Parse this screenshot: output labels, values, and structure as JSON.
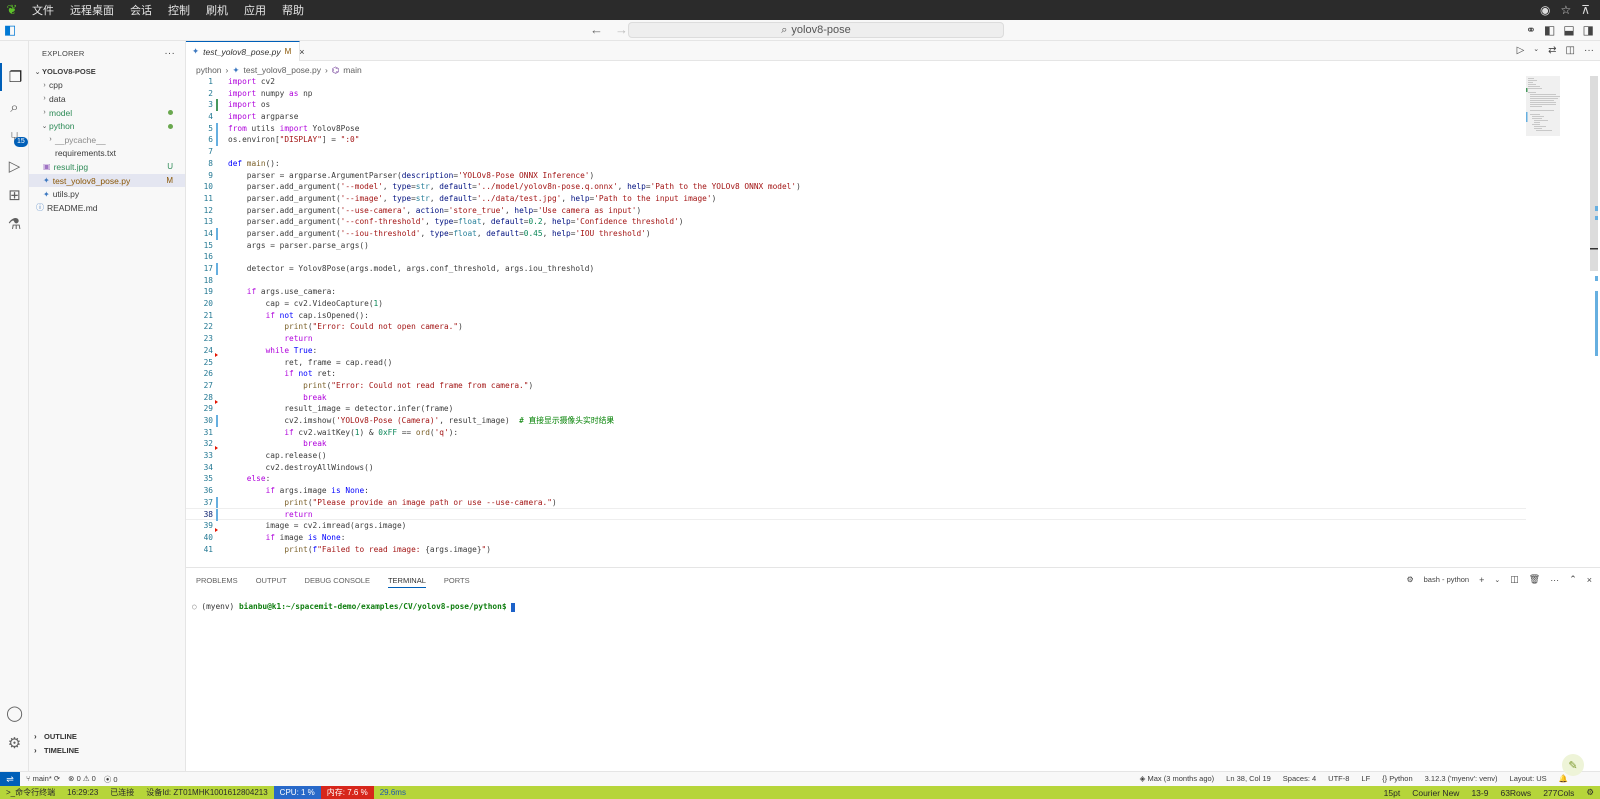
{
  "remote_menu": {
    "items": [
      "文件",
      "远程桌面",
      "会话",
      "控制",
      "刷机",
      "应用",
      "帮助"
    ]
  },
  "titlebar": {
    "back_icon": "arrow-left-icon",
    "forward_icon": "arrow-right-icon",
    "search_text": "yolov8-pose"
  },
  "activity_bar": {
    "items": [
      "explorer",
      "search",
      "source-control",
      "run-debug",
      "extensions",
      "testing"
    ],
    "scm_badge": "15"
  },
  "sidebar": {
    "title": "EXPLORER",
    "root": "YOLOV8-POSE",
    "tree": [
      {
        "label": "cpp",
        "type": "folder",
        "status": ""
      },
      {
        "label": "data",
        "type": "folder",
        "status": ""
      },
      {
        "label": "model",
        "type": "folder",
        "status": "dot"
      },
      {
        "label": "python",
        "type": "folder-open",
        "status": "dot"
      },
      {
        "label": "__pycache__",
        "type": "folder",
        "status": ""
      },
      {
        "label": "requirements.txt",
        "type": "file",
        "status": ""
      },
      {
        "label": "result.jpg",
        "type": "file",
        "status": "U"
      },
      {
        "label": "test_yolov8_pose.py",
        "type": "file",
        "status": "M"
      },
      {
        "label": "utils.py",
        "type": "file",
        "status": ""
      },
      {
        "label": "README.md",
        "type": "file",
        "status": ""
      }
    ],
    "outline": "OUTLINE",
    "timeline": "TIMELINE"
  },
  "editor": {
    "tab_label": "test_yolov8_pose.py",
    "tab_status": "M",
    "breadcrumb": [
      "python",
      "test_yolov8_pose.py",
      "main"
    ],
    "current_line": 38
  },
  "panel": {
    "tabs": [
      "PROBLEMS",
      "OUTPUT",
      "DEBUG CONSOLE",
      "TERMINAL",
      "PORTS"
    ],
    "active_tab": "TERMINAL",
    "terminal_name": "bash - python",
    "prompt_env": "(myenv) ",
    "prompt_user": "bianbu@k1:~/spacemit-demo/examples/CV/yolov8-pose/python$"
  },
  "statusbar": {
    "branch": "main*",
    "errors": "0",
    "warnings": "0",
    "ports": "0",
    "blame": "Max (3 months ago)",
    "position": "Ln 38, Col 19",
    "spaces": "Spaces: 4",
    "encoding": "UTF-8",
    "eol": "LF",
    "language": "Python",
    "interpreter": "3.12.3 ('myenv': venv)",
    "layout": "Layout: US"
  },
  "remote_status": {
    "terminal": "命令行终端",
    "time": "16:29:23",
    "connection": "已连接",
    "device": "设备Id: ZT01MHK1001612804213",
    "cpu": "CPU: 1 %",
    "memory": "内存: 7.6 %",
    "latency": "29.6ms",
    "font_size": "15pt",
    "font_name": "Courier New",
    "cursor": "13-9",
    "rows": "63Rows",
    "cols": "277Cols"
  },
  "colors": {
    "accent": "#005fb8",
    "remote_bar": "#b6d53a",
    "cpu_bg": "#2869c9",
    "mem_bg": "#d7261b"
  }
}
